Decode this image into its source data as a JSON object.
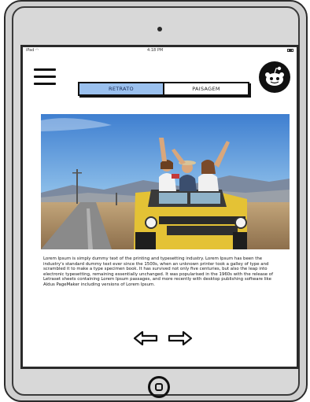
{
  "status_bar": {
    "device": "iPad",
    "time": "4:18 PM"
  },
  "header": {
    "menu_icon": "hamburger-menu-icon",
    "avatar_icon": "reddit-alien-icon"
  },
  "orientation_toggle": {
    "options": [
      "RETRATO",
      "PAISAGEM"
    ],
    "selected": "RETRATO",
    "active_color": "#9ac0ee"
  },
  "content": {
    "image_description_icon": "photo-friends-on-jeep",
    "paragraph": "Lorem Ipsum is simply dummy text of the printing and typesetting industry. Lorem Ipsum has been the industry's standard dummy text ever since the 1500s, when an unknown printer took a galley of type and scrambled it to make a type specimen book. It has survived not only five centuries, but also the leap into electronic typesetting, remaining essentially unchanged. It was popularised in the 1960s with the release of Letraset sheets containing Lorem Ipsum passages, and more recently with desktop publishing software like Aldus PageMaker including versions of Lorem Ipsum."
  },
  "navigation": {
    "prev_icon": "arrow-left-icon",
    "next_icon": "arrow-right-icon"
  },
  "device_frame": {
    "home_icon": "home-button-icon"
  }
}
